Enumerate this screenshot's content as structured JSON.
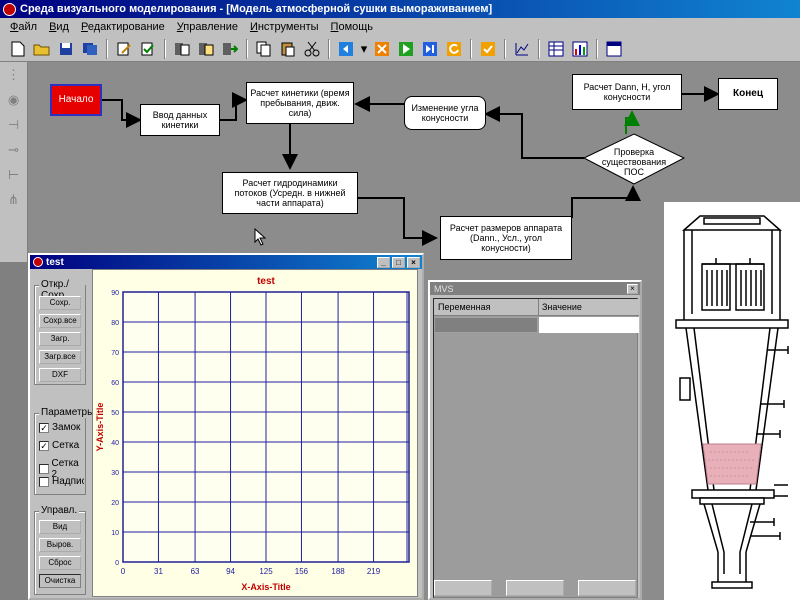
{
  "window": {
    "title": "Среда визуального моделирования - [Модель атмосферной сушки вымораживанием]"
  },
  "menu": [
    "Файл",
    "Вид",
    "Редактирование",
    "Управление",
    "Инструменты",
    "Помощь"
  ],
  "toolbar": {
    "icons": [
      "new-file-icon",
      "open-folder-icon",
      "save-icon",
      "save-all-icon",
      "edit-icon",
      "properties-icon",
      "copy-block-icon",
      "paste-block-icon",
      "export-block-icon",
      "copy-icon",
      "paste-icon",
      "cut-icon",
      "move-left-icon",
      "dropdown-icon",
      "stop-icon",
      "run-icon",
      "step-icon",
      "reset-icon",
      "check-icon",
      "graph-tool-icon",
      "table-icon",
      "chart-icon",
      "window-icon"
    ]
  },
  "flowchart": {
    "start": "Начало",
    "input_kinetics": "Ввод данных кинетики",
    "calc_kinetics": "Расчет кинетики (время пребывания, движ. сила)",
    "calc_hydro": "Расчет гидродинамики потоков (Усредн. в нижней части аппарата)",
    "calc_sizes": "Расчет размеров аппарата (Dann., Усл., угол конусности)",
    "check_pos": "Проверка существования ПОС",
    "change_angle": "Изменение угла конусности",
    "calc_dann": "Расчет Dann, H, угол конусности",
    "end": "Конец"
  },
  "graph_window": {
    "title": "test",
    "group_file": "Откр./Сохр.",
    "buttons_file": [
      "Сохр.",
      "Сохр.все",
      "Загр.",
      "Загр.все",
      "DXF"
    ],
    "group_params": "Параметры",
    "checkboxes": [
      {
        "label": "Замок",
        "checked": true
      },
      {
        "label": "Сетка",
        "checked": true
      },
      {
        "label": "Сетка 2",
        "checked": false
      },
      {
        "label": "Надписи",
        "checked": false
      }
    ],
    "group_control": "Управл.",
    "buttons_control": [
      "Вид",
      "Выров.",
      "Сброс",
      "Очистка"
    ]
  },
  "chart_data": {
    "type": "line",
    "title": "test",
    "xlabel": "X-Axis-Title",
    "ylabel": "Y-Axis-Title",
    "x_ticks": [
      "0",
      "31",
      "63",
      "94",
      "125",
      "156",
      "188",
      "219"
    ],
    "y_ticks": [
      "0",
      "10",
      "20",
      "30",
      "40",
      "50",
      "60",
      "70",
      "80",
      "90"
    ],
    "xlim": [
      0,
      250
    ],
    "ylim": [
      0,
      90
    ],
    "grid": true,
    "series": []
  },
  "mvs_window": {
    "title": "MVS",
    "col_variable": "Переменная",
    "col_value": "Значение"
  }
}
